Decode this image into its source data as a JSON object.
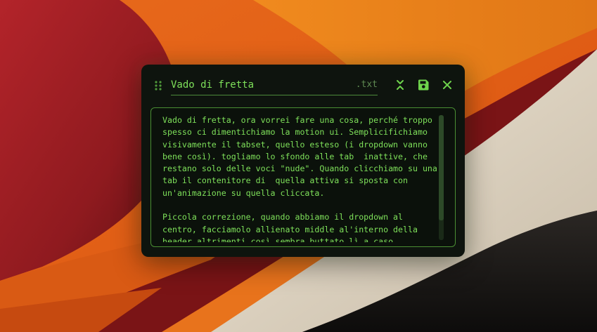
{
  "colors": {
    "accent": "#7ee05a",
    "window_bg": "#0e140e",
    "border": "#4a8e33"
  },
  "note": {
    "title": "Vado di fretta",
    "extension": ".txt",
    "content": "Vado di fretta, ora vorrei fare una cosa, perché troppo spesso ci dimentichiamo la motion ui. Semplicifichiamo visivamente il tabset, quello esteso (i dropdown vanno bene così). togliamo lo sfondo alle tab  inattive, che restano solo delle voci \"nude\". Quando clicchiamo su una tab il contenitore di  quella attiva si sposta con un'animazione su quella cliccata.\n\nPiccola correzione, quando abbiamo il dropdown al centro, facciamolo allienato middle al'interno della header altrimenti così sembra buttato lì a caso"
  },
  "toolbar": {
    "drag_icon": "drag-handle-icon",
    "collapse_icon": "collapse-icon",
    "save_icon": "save-icon",
    "close_icon": "close-icon"
  }
}
